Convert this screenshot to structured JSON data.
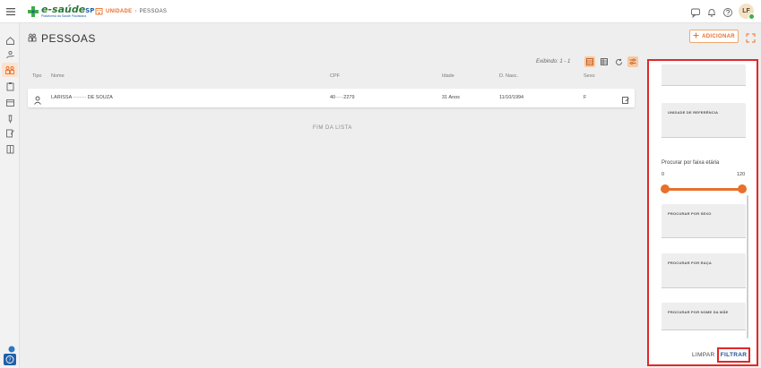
{
  "header": {
    "logo_main": "e-saúde",
    "logo_sp": "SP",
    "logo_sub": "Plataforma da Saúde Paulistana",
    "breadcrumb_unit": "UNIDADE",
    "breadcrumb_sep": "›",
    "breadcrumb_current": "PESSOAS",
    "user_initials": "LF"
  },
  "page": {
    "title": "PESSOAS",
    "add_label": "ADICIONAR"
  },
  "list": {
    "showing": "Exibindo: 1 - 1",
    "columns": [
      "Tipo",
      "Nome",
      "CPF",
      "Idade",
      "D. Nasc.",
      "Sexo"
    ],
    "rows": [
      {
        "name": "LARISSA ········ DE SOUZA",
        "cpf": "40·····2279",
        "age": "31 Anos",
        "birth": "11/10/1994",
        "sex": "F"
      }
    ],
    "end_label": "FIM DA LISTA"
  },
  "filters": {
    "unit_ref_label": "UNIDADE DE REFERÊNCIA",
    "age_label": "Procurar por faixa etária",
    "age_min": "0",
    "age_max": "120",
    "age_range": [
      0,
      120
    ],
    "sex_label": "PROCURAR POR SEXO",
    "race_label": "PROCURAR POR RAÇA",
    "mother_label": "PROCURAR POR NOME DA MÃE",
    "clear_label": "LIMPAR",
    "apply_label": "FILTRAR"
  },
  "colors": {
    "accent": "#e8702a",
    "highlight": "#e02828",
    "brand_green": "#2b7a3a",
    "brand_blue": "#1f5fa8"
  },
  "icons": [
    "menu-icon",
    "home-icon",
    "people-icon",
    "calendar-icon",
    "bell-icon",
    "help-icon",
    "filter-icon",
    "refresh-icon"
  ]
}
